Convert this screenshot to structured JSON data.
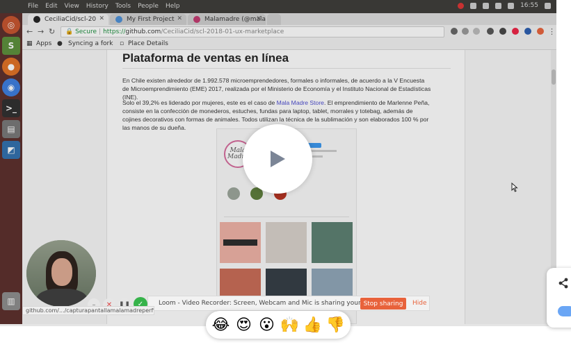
{
  "desktop": {
    "menu": [
      "File",
      "Edit",
      "View",
      "History",
      "Tools",
      "People",
      "Help"
    ],
    "clock": "16:55"
  },
  "browser": {
    "tabs": [
      {
        "label": "CeciliaCid/scl-20"
      },
      {
        "label": "My First Project"
      },
      {
        "label": "Malamadre (@mala"
      }
    ],
    "secure_label": "Secure",
    "url_https": "https://",
    "url_host": "github.com",
    "url_path": "/CeciliaCid/scl-2018-01-ux-marketplace",
    "bookmarks": [
      "Apps",
      "Syncing a fork",
      "Place Details"
    ]
  },
  "article": {
    "title": "Plataforma de ventas en línea",
    "p1": "En Chile existen alrededor de 1.992.578 microemprendedores, formales o informales, de acuerdo a la V Encuesta de Microemprendimiento (EME) 2017, realizada por el Ministerio de Economía y el Instituto Nacional de Estadísticas (INE).",
    "p2_before": "Solo el 39,2% es liderado por mujeres, este es el caso de ",
    "p2_link": "Mala Madre Store",
    "p2_after": ". El emprendimiento de Marlenne Peña, consiste en la confección de monederos, estuches, fundas para laptop, tablet, morrales y totebag, además de cojines decorativos con formas de animales. Todos utilizan la técnica de la sublimación y son elaborados 100 % por las manos de su dueña.",
    "insta_profile_text": "Mala Madre"
  },
  "loom": {
    "message": "Loom - Video Recorder: Screen, Webcam and Mic is sharing your screen.",
    "stop_label": "Stop sharing",
    "hide_label": "Hide"
  },
  "status_url": "github.com/.../capturapantallamalamadreperfil.p",
  "reactions": [
    "😂",
    "😍",
    "😮",
    "🙌",
    "👍",
    "👎"
  ],
  "colors": {
    "accent_orange": "#e8623b",
    "link": "#4a4ad0",
    "ubuntu_bar": "#3c3b37",
    "launcher": "#5b2d2a"
  }
}
